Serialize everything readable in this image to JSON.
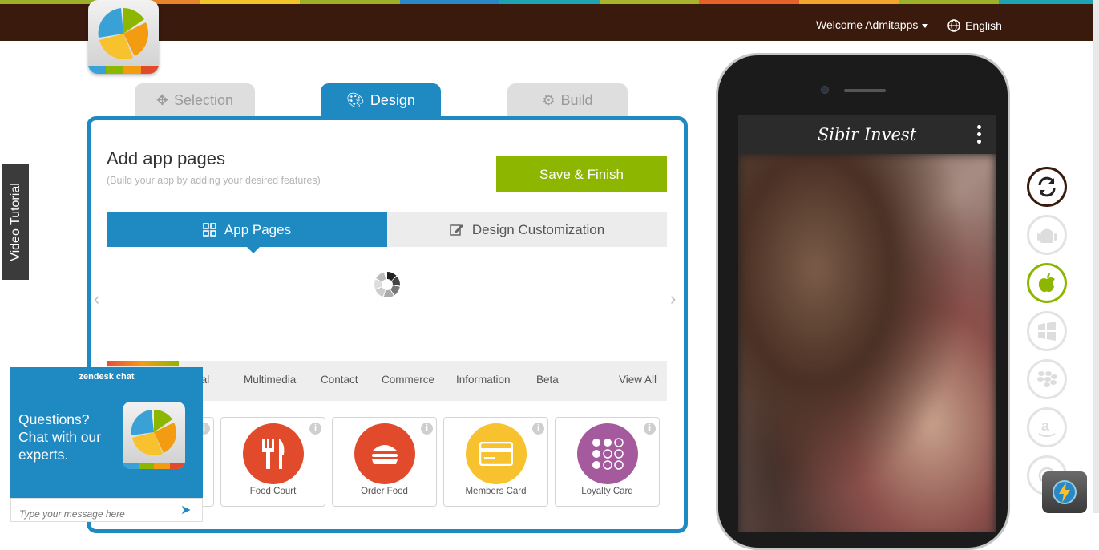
{
  "topbar": {
    "welcome": "Welcome Admitapps",
    "language": "English"
  },
  "stripe_colors": [
    "#9bb12a",
    "#e8842c",
    "#f3c32a",
    "#9bb12a",
    "#2b88c6",
    "#1fa3b0",
    "#a9b32b",
    "#e7622a",
    "#f2a52a",
    "#9bb12a",
    "#1fa3b0"
  ],
  "wizard_tabs": [
    {
      "label": "Selection",
      "icon": "crosshair-icon",
      "state": "inactive"
    },
    {
      "label": "Design",
      "icon": "palette-icon",
      "state": "active"
    },
    {
      "label": "Build",
      "icon": "gears-icon",
      "state": "inactive"
    }
  ],
  "main": {
    "title": "Add app pages",
    "subtitle": "(Build your app by adding your desired features)",
    "save_label": "Save & Finish",
    "segments": [
      {
        "label": "App Pages",
        "icon": "grid-icon",
        "active": true
      },
      {
        "label": "Design Customization",
        "icon": "edit-icon",
        "active": false
      }
    ]
  },
  "categories": [
    "cial",
    "Multimedia",
    "Contact",
    "Commerce",
    "Information",
    "Beta",
    "View All"
  ],
  "features": [
    {
      "label": "Food Court",
      "color": "#e14b2c",
      "icon": "fork-knife-icon"
    },
    {
      "label": "Order Food",
      "color": "#e14b2c",
      "icon": "burger-icon"
    },
    {
      "label": "Members Card",
      "color": "#f7c22e",
      "icon": "credit-card-icon"
    },
    {
      "label": "Loyalty Card",
      "color": "#a55a9e",
      "icon": "dots-grid-icon"
    }
  ],
  "phone": {
    "app_title": "Sibir Invest"
  },
  "platforms": [
    "refresh-icon",
    "android-icon",
    "apple-icon",
    "windows-icon",
    "blackberry-icon",
    "amazon-icon",
    "other-icon"
  ],
  "video_tutorial": "Video Tutorial",
  "chat": {
    "header": "zendesk chat",
    "question": "Questions? Chat with our experts.",
    "placeholder": "Type your message here"
  }
}
